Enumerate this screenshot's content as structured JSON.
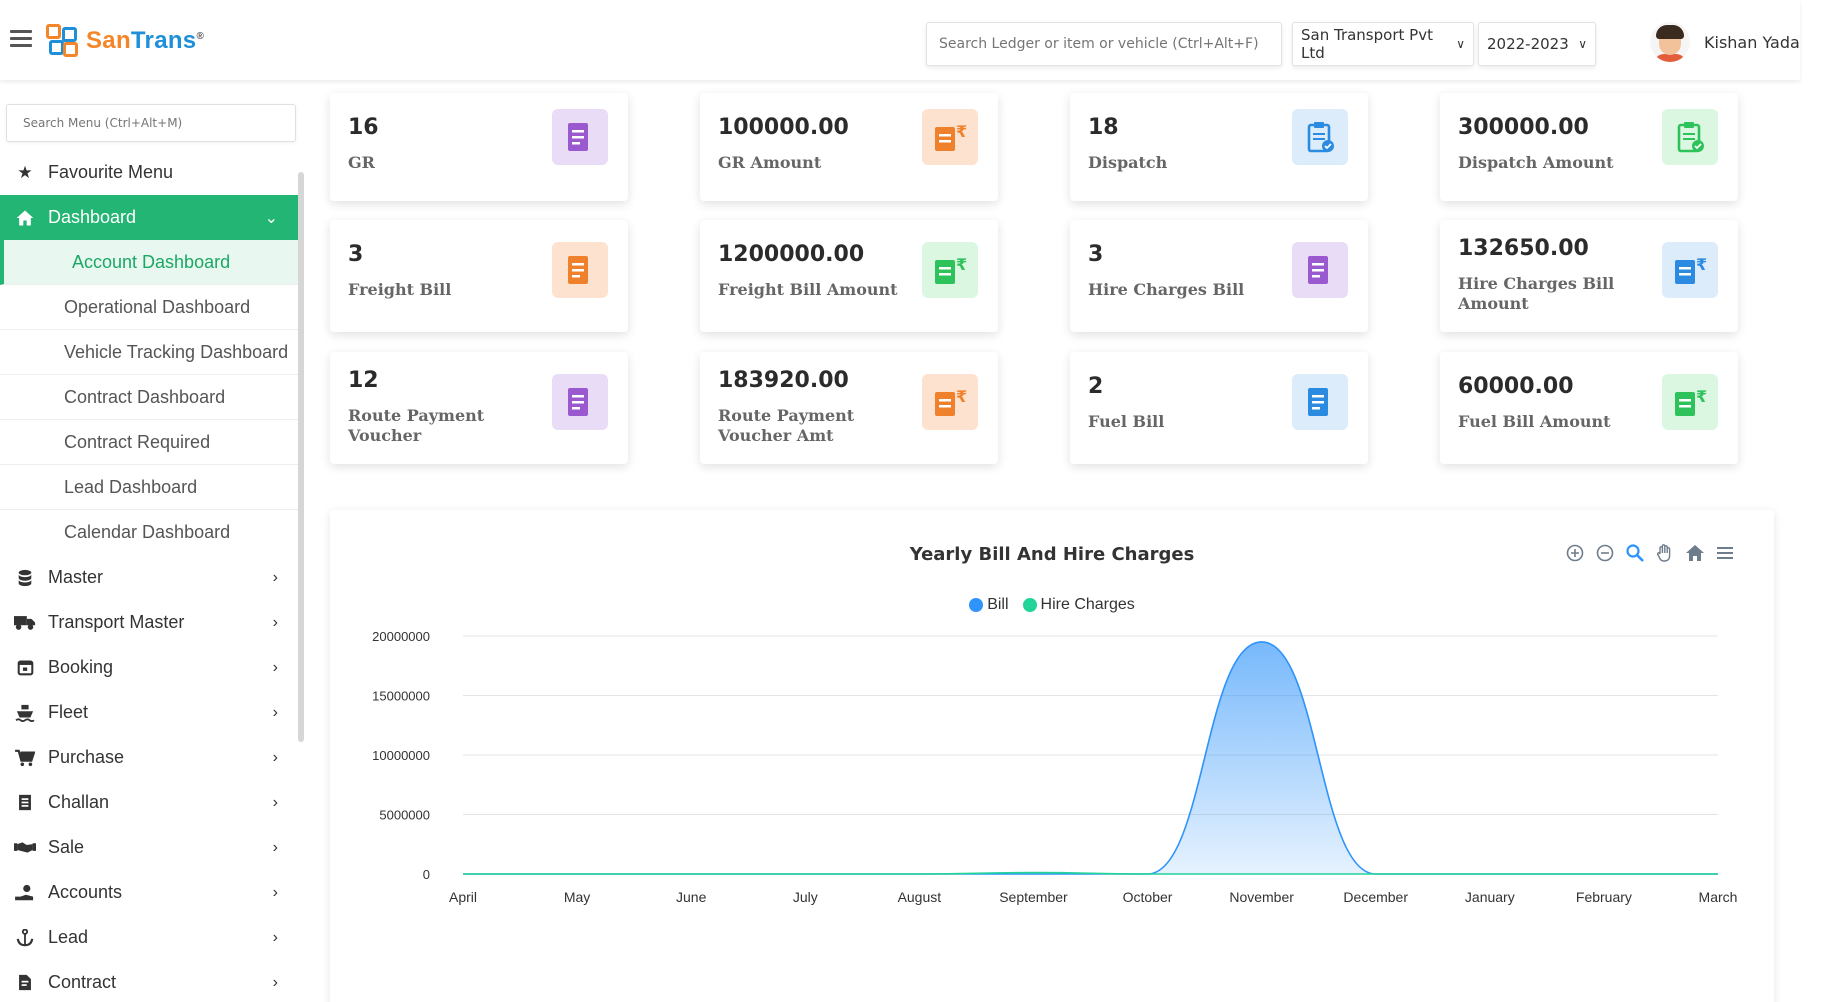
{
  "header": {
    "logo_part1": "San",
    "logo_part2": "Trans",
    "logo_reg": "®",
    "search_placeholder": "Search Ledger or item or vehicle (Ctrl+Alt+F)",
    "company": "San Transport Pvt Ltd",
    "year": "2022-2023",
    "user_name": "Kishan Yadav"
  },
  "sidebar": {
    "search_placeholder": "Search Menu (Ctrl+Alt+M)",
    "favourite": "Favourite Menu",
    "dashboard": "Dashboard",
    "sub_items": [
      "Account Dashboard",
      "Operational Dashboard",
      "Vehicle Tracking Dashboard",
      "Contract Dashboard",
      "Contract Required",
      "Lead Dashboard",
      "Calendar Dashboard"
    ],
    "items": [
      {
        "label": "Master",
        "icon": "database-icon"
      },
      {
        "label": "Transport Master",
        "icon": "truck-icon"
      },
      {
        "label": "Booking",
        "icon": "calendar-icon"
      },
      {
        "label": "Fleet",
        "icon": "ship-icon"
      },
      {
        "label": "Purchase",
        "icon": "cart-icon"
      },
      {
        "label": "Challan",
        "icon": "receipt-icon"
      },
      {
        "label": "Sale",
        "icon": "handshake-icon"
      },
      {
        "label": "Accounts",
        "icon": "hand-money-icon"
      },
      {
        "label": "Lead",
        "icon": "anchor-icon"
      },
      {
        "label": "Contract",
        "icon": "file-contract-icon"
      }
    ]
  },
  "cards": [
    {
      "value": "16",
      "label": "GR",
      "color": "#e9dcf7",
      "icon_color": "#9b59d0",
      "icon": "gr-edit-icon"
    },
    {
      "value": "100000.00",
      "label": "GR Amount",
      "color": "#fde3cf",
      "icon_color": "#f0812c",
      "icon": "gr-rupee-icon"
    },
    {
      "value": "18",
      "label": "Dispatch",
      "color": "#dcecfb",
      "icon_color": "#2a8be0",
      "icon": "clipboard-check-icon"
    },
    {
      "value": "300000.00",
      "label": "Dispatch Amount",
      "color": "#dcf7e1",
      "icon_color": "#2ec35a",
      "icon": "clipboard-check-icon"
    },
    {
      "value": "3",
      "label": "Freight Bill",
      "color": "#fde3cf",
      "icon_color": "#f0812c",
      "icon": "box-icon"
    },
    {
      "value": "1200000.00",
      "label": "Freight Bill Amount",
      "color": "#dcf7e1",
      "icon_color": "#2ec35a",
      "icon": "box-rupee-icon"
    },
    {
      "value": "3",
      "label": "Hire Charges Bill",
      "color": "#e9dcf7",
      "icon_color": "#9b59d0",
      "icon": "document-icon"
    },
    {
      "value": "132650.00",
      "label": "Hire Charges Bill Amount",
      "color": "#dcecfb",
      "icon_color": "#2a8be0",
      "icon": "document-rupee-icon"
    },
    {
      "value": "12",
      "label": "Route Payment Voucher",
      "color": "#e9dcf7",
      "icon_color": "#9b59d0",
      "icon": "route-voucher-icon"
    },
    {
      "value": "183920.00",
      "label": "Route Payment Voucher Amt",
      "color": "#fde3cf",
      "icon_color": "#f0812c",
      "icon": "route-rupee-icon"
    },
    {
      "value": "2",
      "label": "Fuel Bill",
      "color": "#dcecfb",
      "icon_color": "#2a8be0",
      "icon": "fuel-icon"
    },
    {
      "value": "60000.00",
      "label": "Fuel Bill Amount",
      "color": "#dcf7e1",
      "icon_color": "#2ec35a",
      "icon": "fuel-rupee-icon"
    }
  ],
  "chart_data": {
    "type": "area",
    "title": "Yearly Bill And Hire Charges",
    "categories": [
      "April",
      "May",
      "June",
      "July",
      "August",
      "September",
      "October",
      "November",
      "December",
      "January",
      "February",
      "March"
    ],
    "series": [
      {
        "name": "Bill",
        "color": "#2e93fa",
        "values": [
          0,
          0,
          0,
          0,
          0,
          0,
          0,
          19500000,
          0,
          0,
          0,
          0
        ]
      },
      {
        "name": "Hire Charges",
        "color": "#22d39a",
        "values": [
          0,
          0,
          0,
          0,
          0,
          120000,
          0,
          0,
          0,
          0,
          0,
          0
        ]
      }
    ],
    "yticks": [
      "0",
      "5000000",
      "10000000",
      "15000000",
      "20000000"
    ],
    "ylim": [
      0,
      20000000
    ],
    "grid": true,
    "legend": "top-center"
  }
}
